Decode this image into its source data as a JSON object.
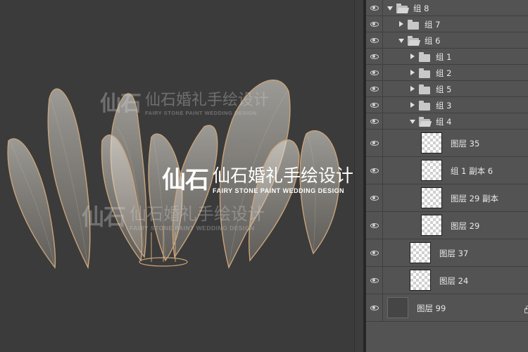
{
  "canvas": {
    "watermark_logo": "仙石",
    "watermark_cn": "仙石婚礼手绘设计",
    "watermark_en": "FAIRY STONE PAINT WEDDING DESIGN"
  },
  "layers": [
    {
      "name": "组 8",
      "kind": "group",
      "expanded": true,
      "depth": 0
    },
    {
      "name": "组 7",
      "kind": "group",
      "expanded": false,
      "depth": 1
    },
    {
      "name": "组 6",
      "kind": "group",
      "expanded": true,
      "depth": 1
    },
    {
      "name": "组 1",
      "kind": "group",
      "expanded": false,
      "depth": 2
    },
    {
      "name": "组 2",
      "kind": "group",
      "expanded": false,
      "depth": 2
    },
    {
      "name": "组 5",
      "kind": "group",
      "expanded": false,
      "depth": 2
    },
    {
      "name": "组 3",
      "kind": "group",
      "expanded": false,
      "depth": 2
    },
    {
      "name": "组 4",
      "kind": "group",
      "expanded": true,
      "depth": 2
    },
    {
      "name": "图层 35",
      "kind": "layer",
      "depth": 3
    },
    {
      "name": "组 1 副本 6",
      "kind": "layer",
      "depth": 3
    },
    {
      "name": "图层 29 副本",
      "kind": "layer",
      "depth": 3
    },
    {
      "name": "图层 29",
      "kind": "layer",
      "depth": 3
    },
    {
      "name": "图层 37",
      "kind": "layer",
      "depth": 2
    },
    {
      "name": "图层 24",
      "kind": "layer",
      "depth": 2
    },
    {
      "name": "图层 99",
      "kind": "layer",
      "depth": 0,
      "locked": true,
      "dark": true
    }
  ],
  "icons": {
    "visibility": "eye-icon",
    "group": "folder-icon",
    "lock": "lock-icon"
  },
  "colors": {
    "canvas_bg": "#3b3b3b",
    "panel_bg": "#535353",
    "leaf_stroke": "#c9a47a",
    "leaf_fill": "#e8e4dc"
  }
}
